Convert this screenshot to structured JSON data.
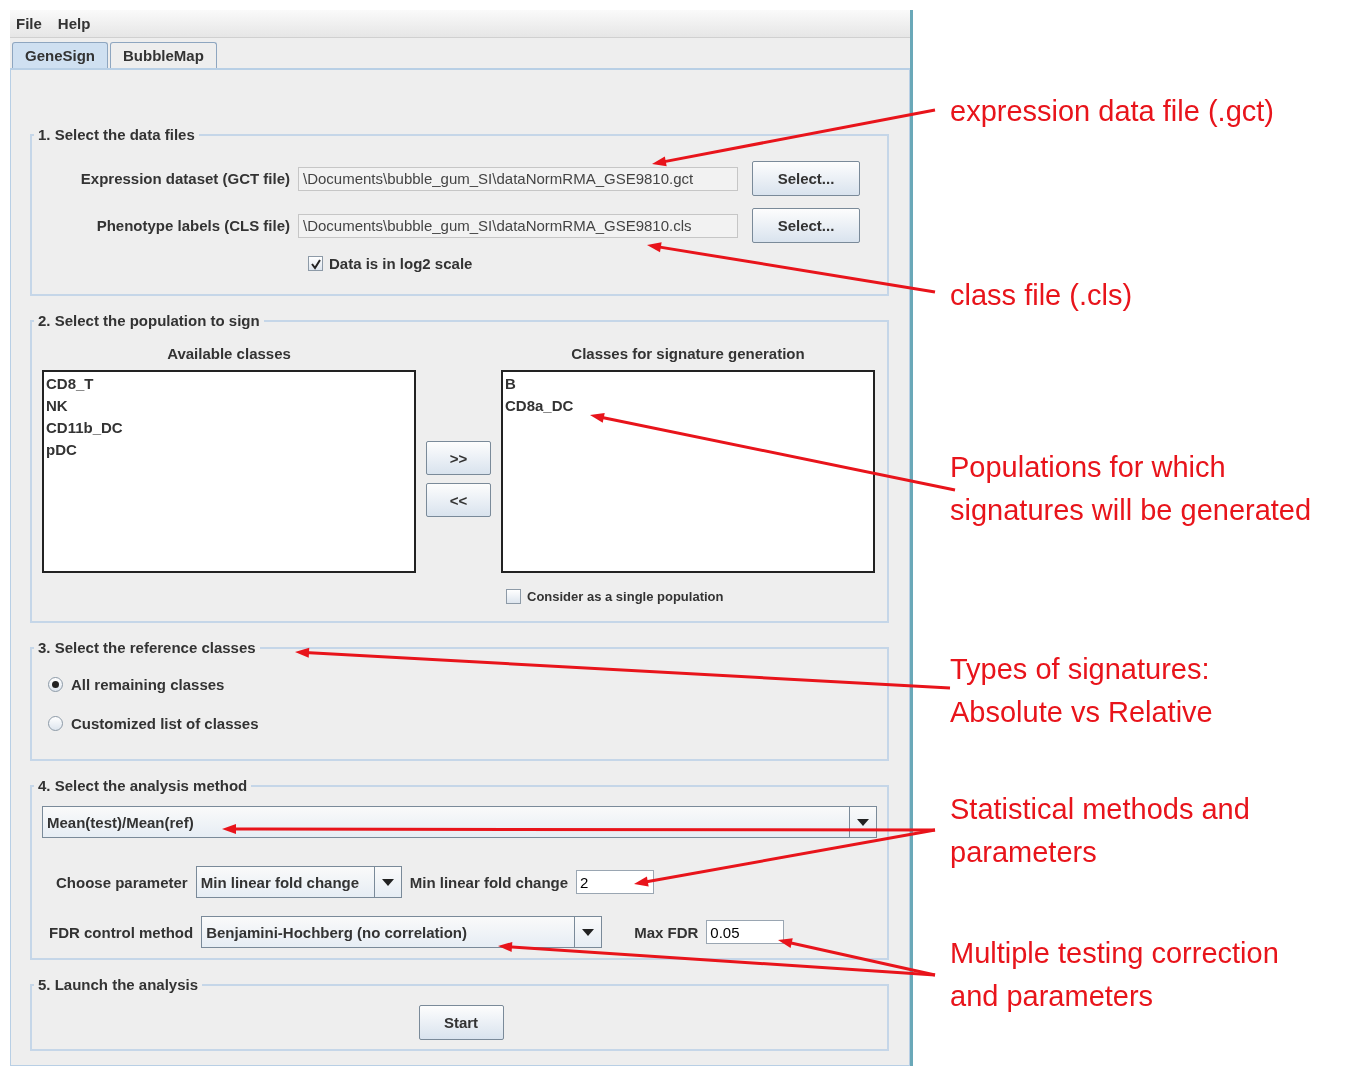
{
  "menu": [
    "File",
    "Help"
  ],
  "tabs": [
    {
      "label": "GeneSign",
      "selected": true
    },
    {
      "label": "BubbleMap",
      "selected": false
    }
  ],
  "data_files": {
    "title": "1. Select the data files",
    "rows": [
      {
        "label": "Expression dataset (GCT file)",
        "value": "\\Documents\\bubble_gum_SI\\dataNormRMA_GSE9810.gct",
        "button": "Select..."
      },
      {
        "label": "Phenotype labels (CLS file)",
        "value": "\\Documents\\bubble_gum_SI\\dataNormRMA_GSE9810.cls",
        "button": "Select..."
      }
    ],
    "log2": {
      "label": "Data is in log2 scale",
      "checked": true
    }
  },
  "population": {
    "title": "2. Select the population to sign",
    "available": {
      "title": "Available classes",
      "items": [
        "CD8_T",
        "NK",
        "CD11b_DC",
        "pDC"
      ]
    },
    "move_buttons": [
      ">>",
      "<<"
    ],
    "chosen": {
      "title": "Classes for signature generation",
      "items": [
        "B",
        "CD8a_DC"
      ]
    },
    "single": {
      "label": "Consider as a single population",
      "checked": false
    }
  },
  "reference": {
    "title": "3. Select the reference classes",
    "options": [
      {
        "label": "All remaining classes",
        "selected": true
      },
      {
        "label": "Customized list of classes",
        "selected": false
      }
    ]
  },
  "method": {
    "title": "4. Select the analysis method",
    "method": "Mean(test)/Mean(ref)",
    "param_label": "Choose parameter",
    "param_value": "Min linear fold change",
    "threshold_label": "Min linear fold change",
    "threshold_value": "2",
    "fdr_label": "FDR control method",
    "fdr_value": "Benjamini-Hochberg (no correlation)",
    "max_fdr_label": "Max FDR",
    "max_fdr_value": "0.05"
  },
  "launch": {
    "title": "5. Launch the analysis",
    "button": "Start"
  },
  "annotations": [
    {
      "lines": [
        "expression data file (.gct)"
      ]
    },
    {
      "lines": [
        "class file (.cls)"
      ]
    },
    {
      "lines": [
        "Populations for which",
        "signatures will be generated"
      ]
    },
    {
      "lines": [
        "Types of signatures:",
        "Absolute vs Relative"
      ]
    },
    {
      "lines": [
        "Statistical methods and",
        "parameters"
      ]
    },
    {
      "lines": [
        "Multiple testing correction",
        "and parameters"
      ]
    }
  ]
}
